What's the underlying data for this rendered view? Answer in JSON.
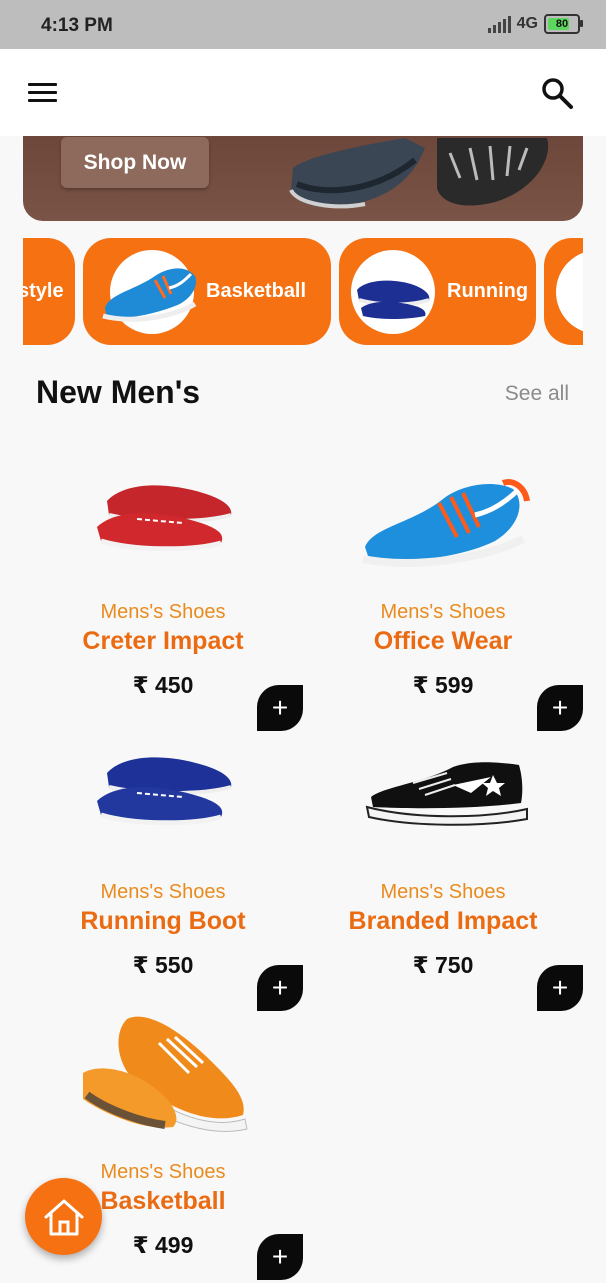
{
  "status_bar": {
    "time": "4:13 PM",
    "network": "4G",
    "battery": "80",
    "battery_level": 0.8
  },
  "banner": {
    "button_label": "Shop Now"
  },
  "categories": [
    {
      "label": "style",
      "icon": "shoe-icon"
    },
    {
      "label": "Basketball",
      "icon": "blue-sneaker-icon"
    },
    {
      "label": "Running",
      "icon": "navy-shoe-icon"
    }
  ],
  "section": {
    "title": "New Men's",
    "see_all": "See all"
  },
  "products": [
    {
      "category": "Mens's Shoes",
      "name": "Creter Impact",
      "price": "₹ 450",
      "add": "+"
    },
    {
      "category": "Mens's Shoes",
      "name": "Office Wear",
      "price": "₹ 599",
      "add": "+"
    },
    {
      "category": "Mens's Shoes",
      "name": "Running Boot",
      "price": "₹ 550",
      "add": "+"
    },
    {
      "category": "Mens's Shoes",
      "name": "Branded Impact",
      "price": "₹ 750",
      "add": "+"
    },
    {
      "category": "Mens's Shoes",
      "name": "Basketball",
      "price": "₹ 499",
      "add": "+"
    }
  ],
  "colors": {
    "accent": "#f57112",
    "category_text": "#ea8b1e",
    "name_text": "#ea6b12",
    "banner": "#6a4438"
  }
}
